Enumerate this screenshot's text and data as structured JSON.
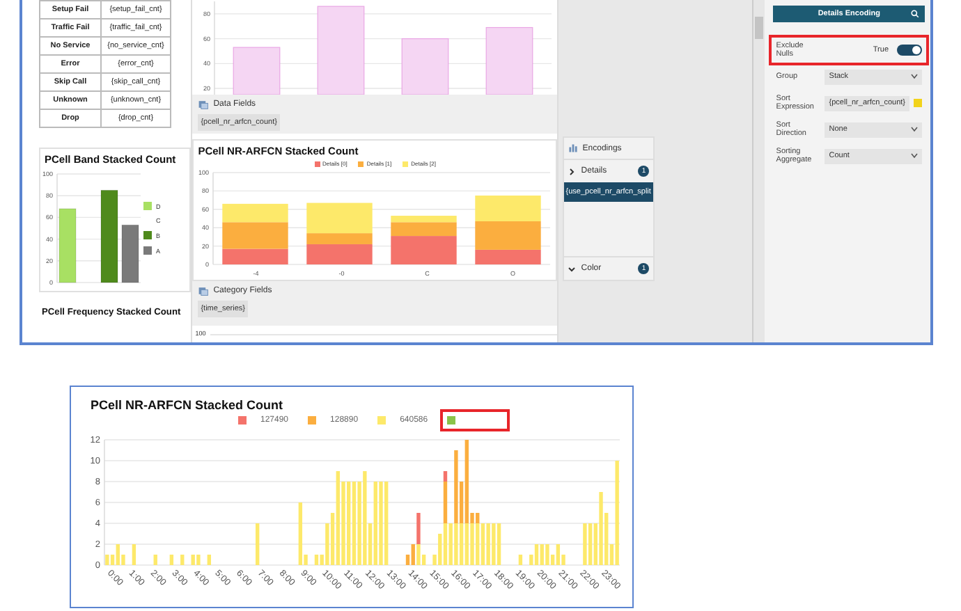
{
  "top_screenshot": {
    "metrics_table": {
      "rows": [
        {
          "label": "Setup Fail",
          "field": "{setup_fail_cnt}"
        },
        {
          "label": "Traffic Fail",
          "field": "{traffic_fail_cnt}"
        },
        {
          "label": "No Service",
          "field": "{no_service_cnt}"
        },
        {
          "label": "Error",
          "field": "{error_cnt}"
        },
        {
          "label": "Skip Call",
          "field": "{skip_call_cnt}"
        },
        {
          "label": "Unknown",
          "field": "{unknown_cnt}"
        },
        {
          "label": "Drop",
          "field": "{drop_cnt}"
        }
      ]
    },
    "count_chart": {
      "chart_data": {
        "type": "bar",
        "ylim": [
          15,
          90
        ],
        "grid": true,
        "yticks": [
          20,
          40,
          60,
          80
        ],
        "series": [
          {
            "color": "#f5d6f3",
            "values": [
              53,
              86,
              60,
              69
            ]
          }
        ]
      }
    },
    "data_fields": {
      "title": "Data Fields",
      "fields": [
        "{pcell_nr_arfcn_count}"
      ]
    },
    "band_chart": {
      "title": "PCell Band Stacked Count",
      "chart_data": {
        "type": "bar",
        "ylim": [
          0,
          100
        ],
        "grid": true,
        "yticks": [
          0,
          20,
          40,
          60,
          80,
          100
        ],
        "series": [
          {
            "name": "D",
            "color": "#a8e063",
            "values": [
              68
            ]
          },
          {
            "name": "C",
            "values": [
              0
            ]
          },
          {
            "name": "B",
            "color": "#4f8a1c",
            "values": [
              85
            ]
          },
          {
            "name": "A",
            "color": "#7a7a7a",
            "values": [
              53
            ]
          }
        ]
      }
    },
    "arfcn_chart": {
      "title": "PCell NR-ARFCN Stacked Count",
      "chart_data": {
        "type": "bar",
        "stacked": true,
        "categories": [
          "-4",
          "-0",
          "C",
          "O"
        ],
        "ylim": [
          0,
          100
        ],
        "grid": true,
        "yticks": [
          0,
          20,
          40,
          60,
          80,
          100
        ],
        "series": [
          {
            "name": "Details [0]",
            "color": "#f4736b",
            "values": [
              17,
              22,
              31,
              16
            ]
          },
          {
            "name": "Details [1]",
            "color": "#fbae3f",
            "values": [
              29,
              12,
              15,
              31
            ]
          },
          {
            "name": "Details [2]",
            "color": "#fde96a",
            "values": [
              20,
              33,
              7,
              28
            ]
          }
        ]
      }
    },
    "category_fields": {
      "title": "Category Fields",
      "fields": [
        "{time_series}"
      ]
    },
    "frequency_chart": {
      "title": "PCell Frequency Stacked Count",
      "y_tick": "100"
    },
    "encodings": {
      "title": "Encodings",
      "groups": [
        {
          "label": "Details",
          "count": "1",
          "expanded": false,
          "items": [
            {
              "label": "{use_pcell_nr_arfcn_split",
              "selected": true
            }
          ]
        },
        {
          "label": "Color",
          "count": "1",
          "expanded": true
        }
      ]
    },
    "details_encoding": {
      "title": "Details Encoding",
      "rows": [
        {
          "kind": "toggle",
          "label": "Exclude Nulls",
          "value": "True",
          "on": true,
          "highlighted": true
        },
        {
          "kind": "dropdown",
          "label": "Group",
          "value": "Stack"
        },
        {
          "kind": "expression",
          "label": "Sort Expression",
          "value": "{pcell_nr_arfcn_count}",
          "color": "#f2d31b"
        },
        {
          "kind": "dropdown",
          "label": "Sort Direction",
          "value": "None"
        },
        {
          "kind": "dropdown",
          "label": "Sorting Aggregate",
          "value": "Count"
        }
      ]
    }
  },
  "bottom_screenshot": {
    "title": "PCell NR-ARFCN Stacked Count",
    "legend": [
      {
        "label": "127490",
        "color": "#f4736b",
        "highlighted": false
      },
      {
        "label": "128890",
        "color": "#fbae3f",
        "highlighted": false
      },
      {
        "label": "640586",
        "color": "#fde96a",
        "highlighted": false
      },
      {
        "color": "#8bc34a",
        "highlighted": true
      }
    ],
    "chart_data": {
      "type": "bar",
      "stacked": true,
      "grid": true,
      "xlim": [
        0,
        24
      ],
      "ylim": [
        0,
        12
      ],
      "yticks": [
        0,
        2,
        4,
        6,
        8,
        10,
        12
      ],
      "x": [
        0,
        0.25,
        0.5,
        0.75,
        1,
        1.25,
        1.5,
        1.75,
        2,
        2.25,
        2.5,
        2.75,
        3,
        3.25,
        3.5,
        3.75,
        4,
        4.25,
        4.5,
        4.75,
        5,
        5.25,
        5.5,
        5.75,
        6,
        6.25,
        6.5,
        6.75,
        7,
        7.25,
        7.5,
        7.75,
        8,
        8.25,
        8.5,
        8.75,
        9,
        9.25,
        9.5,
        9.75,
        10,
        10.25,
        10.5,
        10.75,
        11,
        11.25,
        11.5,
        11.75,
        12,
        12.25,
        12.5,
        12.75,
        13,
        13.25,
        13.5,
        13.75,
        14,
        14.25,
        14.5,
        14.75,
        15,
        15.25,
        15.5,
        15.75,
        16,
        16.25,
        16.5,
        16.75,
        17,
        17.25,
        17.5,
        17.75,
        18,
        18.25,
        18.5,
        18.75,
        19,
        19.25,
        19.5,
        19.75,
        20,
        20.25,
        20.5,
        20.75,
        21,
        21.25,
        21.5,
        21.75,
        22,
        22.25,
        22.5,
        22.75,
        23,
        23.25,
        23.5,
        23.75
      ],
      "xticks": [
        {
          "value": 0,
          "label": "0:00"
        },
        {
          "value": 1,
          "label": "1:00"
        },
        {
          "value": 2,
          "label": "2:00"
        },
        {
          "value": 3,
          "label": "3:00"
        },
        {
          "value": 4,
          "label": "4:00"
        },
        {
          "value": 5,
          "label": "5:00"
        },
        {
          "value": 6,
          "label": "6:00"
        },
        {
          "value": 7,
          "label": "7:00"
        },
        {
          "value": 8,
          "label": "8:00"
        },
        {
          "value": 9,
          "label": "9:00"
        },
        {
          "value": 10,
          "label": "10:00"
        },
        {
          "value": 11,
          "label": "11:00"
        },
        {
          "value": 12,
          "label": "12:00"
        },
        {
          "value": 13,
          "label": "13:00"
        },
        {
          "value": 14,
          "label": "14:00"
        },
        {
          "value": 15,
          "label": "15:00"
        },
        {
          "value": 16,
          "label": "16:00"
        },
        {
          "value": 17,
          "label": "17:00"
        },
        {
          "value": 18,
          "label": "18:00"
        },
        {
          "value": 19,
          "label": "19:00"
        },
        {
          "value": 20,
          "label": "20:00"
        },
        {
          "value": 21,
          "label": "21:00"
        },
        {
          "value": 22,
          "label": "22:00"
        },
        {
          "value": 23,
          "label": "23:00"
        }
      ],
      "series": [
        {
          "color": "#fde96a",
          "values": [
            1,
            1,
            2,
            1,
            0,
            2,
            0,
            0,
            0,
            1,
            0,
            0,
            1,
            0,
            1,
            0,
            1,
            1,
            0,
            1,
            0,
            0,
            0,
            0,
            0,
            0,
            0,
            0,
            4,
            0,
            0,
            0,
            0,
            0,
            0,
            0,
            6,
            1,
            0,
            1,
            1,
            4,
            5,
            9,
            8,
            8,
            8,
            8,
            9,
            4,
            8,
            8,
            8,
            0,
            0,
            0,
            0,
            0,
            2,
            1,
            0,
            1,
            3,
            4,
            4,
            4,
            4,
            4,
            4,
            4,
            4,
            4,
            4,
            4,
            0,
            0,
            0,
            1,
            0,
            1,
            2,
            2,
            2,
            1,
            2,
            1,
            0,
            0,
            0,
            4,
            4,
            4,
            7,
            5,
            2,
            10
          ]
        },
        {
          "color": "#fbae3f",
          "values": [
            0,
            0,
            0,
            0,
            0,
            0,
            0,
            0,
            0,
            0,
            0,
            0,
            0,
            0,
            0,
            0,
            0,
            0,
            0,
            0,
            0,
            0,
            0,
            0,
            0,
            0,
            0,
            0,
            0,
            0,
            0,
            0,
            0,
            0,
            0,
            0,
            0,
            0,
            0,
            0,
            0,
            0,
            0,
            0,
            0,
            0,
            0,
            0,
            0,
            0,
            0,
            0,
            0,
            0,
            0,
            0,
            1,
            2,
            0,
            0,
            0,
            0,
            0,
            4,
            0,
            7,
            4,
            8,
            1,
            1,
            0,
            0,
            0,
            0,
            0,
            0,
            0,
            0,
            0,
            0,
            0,
            0,
            0,
            0,
            0,
            0,
            0,
            0,
            0,
            0,
            0,
            0,
            0,
            0,
            0,
            0
          ]
        },
        {
          "color": "#f4736b",
          "values": [
            0,
            0,
            0,
            0,
            0,
            0,
            0,
            0,
            0,
            0,
            0,
            0,
            0,
            0,
            0,
            0,
            0,
            0,
            0,
            0,
            0,
            0,
            0,
            0,
            0,
            0,
            0,
            0,
            0,
            0,
            0,
            0,
            0,
            0,
            0,
            0,
            0,
            0,
            0,
            0,
            0,
            0,
            0,
            0,
            0,
            0,
            0,
            0,
            0,
            0,
            0,
            0,
            0,
            0,
            0,
            0,
            0,
            0,
            3,
            0,
            0,
            0,
            0,
            1,
            0,
            0,
            0,
            0,
            0,
            0,
            0,
            0,
            0,
            0,
            0,
            0,
            0,
            0,
            0,
            0,
            0,
            0,
            0,
            0,
            0,
            0,
            0,
            0,
            0,
            0,
            0,
            0,
            0,
            0,
            0,
            0
          ]
        }
      ]
    }
  }
}
